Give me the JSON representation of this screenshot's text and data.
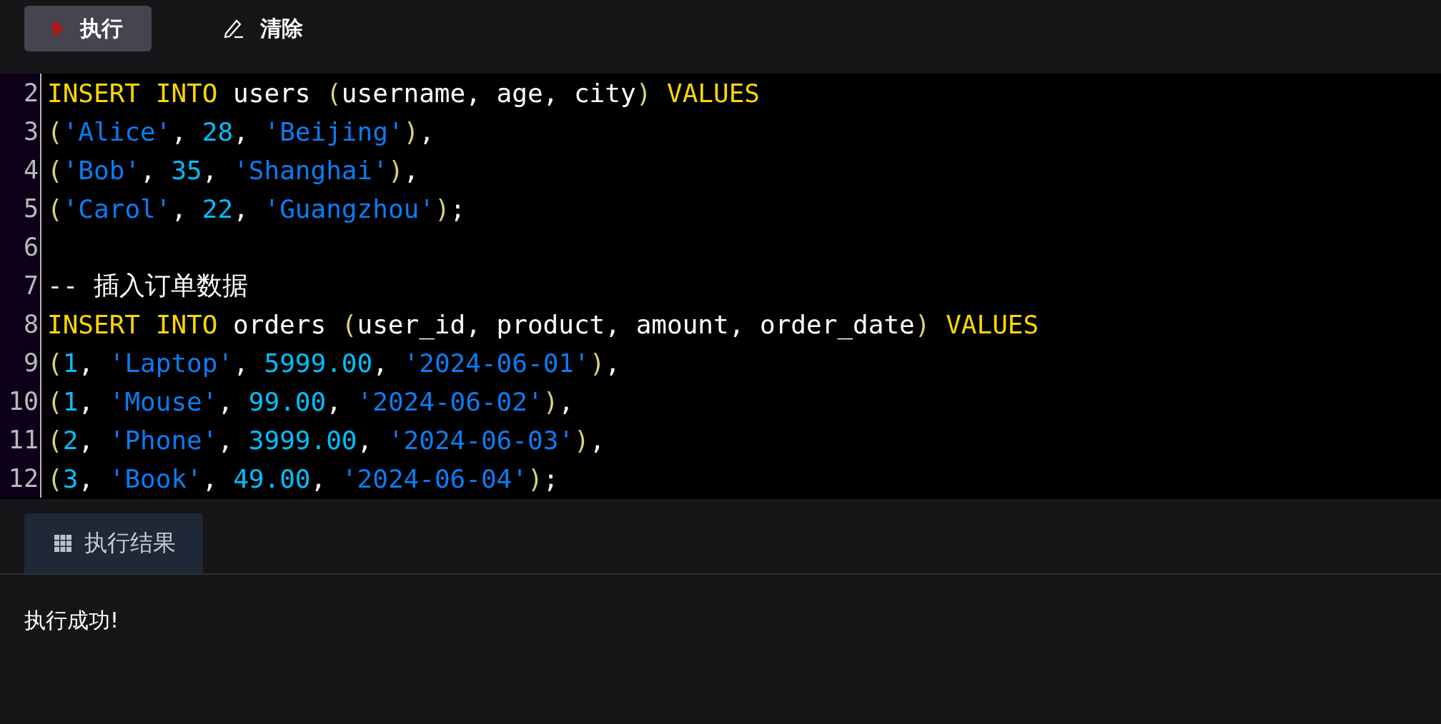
{
  "toolbar": {
    "buttons": [
      {
        "kind": "run",
        "label": "执行",
        "selected": true
      },
      {
        "kind": "clear",
        "label": "清除",
        "selected": false
      }
    ]
  },
  "editor": {
    "lines": [
      {
        "number": "2",
        "tokens": [
          {
            "kind": "keyword",
            "text": "INSERT INTO"
          },
          {
            "kind": "plain",
            "text": " users "
          },
          {
            "kind": "paren",
            "text": "("
          },
          {
            "kind": "plain",
            "text": "username, age, city"
          },
          {
            "kind": "paren",
            "text": ")"
          },
          {
            "kind": "keyword",
            "text": " VALUES"
          }
        ]
      },
      {
        "number": "3",
        "tokens": [
          {
            "kind": "paren",
            "text": "("
          },
          {
            "kind": "string",
            "text": "'Alice'"
          },
          {
            "kind": "plain",
            "text": ", "
          },
          {
            "kind": "number",
            "text": "28"
          },
          {
            "kind": "plain",
            "text": ", "
          },
          {
            "kind": "string",
            "text": "'Beijing'"
          },
          {
            "kind": "paren",
            "text": ")"
          },
          {
            "kind": "plain",
            "text": ","
          }
        ]
      },
      {
        "number": "4",
        "tokens": [
          {
            "kind": "paren",
            "text": "("
          },
          {
            "kind": "string",
            "text": "'Bob'"
          },
          {
            "kind": "plain",
            "text": ", "
          },
          {
            "kind": "number",
            "text": "35"
          },
          {
            "kind": "plain",
            "text": ", "
          },
          {
            "kind": "string",
            "text": "'Shanghai'"
          },
          {
            "kind": "paren",
            "text": ")"
          },
          {
            "kind": "plain",
            "text": ","
          }
        ]
      },
      {
        "number": "5",
        "tokens": [
          {
            "kind": "paren",
            "text": "("
          },
          {
            "kind": "string",
            "text": "'Carol'"
          },
          {
            "kind": "plain",
            "text": ", "
          },
          {
            "kind": "number",
            "text": "22"
          },
          {
            "kind": "plain",
            "text": ", "
          },
          {
            "kind": "string",
            "text": "'Guangzhou'"
          },
          {
            "kind": "paren",
            "text": ")"
          },
          {
            "kind": "plain",
            "text": ";"
          }
        ]
      },
      {
        "number": "6"
      },
      {
        "number": "7",
        "tokens": [
          {
            "kind": "plain",
            "text": "-- 插入订单数据"
          }
        ]
      },
      {
        "number": "8",
        "tokens": [
          {
            "kind": "keyword",
            "text": "INSERT INTO"
          },
          {
            "kind": "plain",
            "text": " orders "
          },
          {
            "kind": "paren",
            "text": "("
          },
          {
            "kind": "plain",
            "text": "user_id, product, amount, order_date"
          },
          {
            "kind": "paren",
            "text": ")"
          },
          {
            "kind": "keyword",
            "text": " VALUES"
          }
        ]
      },
      {
        "number": "9",
        "tokens": [
          {
            "kind": "paren",
            "text": "("
          },
          {
            "kind": "number",
            "text": "1"
          },
          {
            "kind": "plain",
            "text": ", "
          },
          {
            "kind": "string",
            "text": "'Laptop'"
          },
          {
            "kind": "plain",
            "text": ", "
          },
          {
            "kind": "number",
            "text": "5999.00"
          },
          {
            "kind": "plain",
            "text": ", "
          },
          {
            "kind": "string",
            "text": "'2024-06-01'"
          },
          {
            "kind": "paren",
            "text": ")"
          },
          {
            "kind": "plain",
            "text": ","
          }
        ]
      },
      {
        "number": "10",
        "tokens": [
          {
            "kind": "paren",
            "text": "("
          },
          {
            "kind": "number",
            "text": "1"
          },
          {
            "kind": "plain",
            "text": ", "
          },
          {
            "kind": "string",
            "text": "'Mouse'"
          },
          {
            "kind": "plain",
            "text": ", "
          },
          {
            "kind": "number",
            "text": "99.00"
          },
          {
            "kind": "plain",
            "text": ", "
          },
          {
            "kind": "string",
            "text": "'2024-06-02'"
          },
          {
            "kind": "paren",
            "text": ")"
          },
          {
            "kind": "plain",
            "text": ","
          }
        ]
      },
      {
        "number": "11",
        "tokens": [
          {
            "kind": "paren",
            "text": "("
          },
          {
            "kind": "number",
            "text": "2"
          },
          {
            "kind": "plain",
            "text": ", "
          },
          {
            "kind": "string",
            "text": "'Phone'"
          },
          {
            "kind": "plain",
            "text": ", "
          },
          {
            "kind": "number",
            "text": "3999.00"
          },
          {
            "kind": "plain",
            "text": ", "
          },
          {
            "kind": "string",
            "text": "'2024-06-03'"
          },
          {
            "kind": "paren",
            "text": ")"
          },
          {
            "kind": "plain",
            "text": ","
          }
        ]
      },
      {
        "number": "12",
        "tokens": [
          {
            "kind": "paren",
            "text": "("
          },
          {
            "kind": "number",
            "text": "3"
          },
          {
            "kind": "plain",
            "text": ", "
          },
          {
            "kind": "string",
            "text": "'Book'"
          },
          {
            "kind": "plain",
            "text": ", "
          },
          {
            "kind": "number",
            "text": "49.00"
          },
          {
            "kind": "plain",
            "text": ", "
          },
          {
            "kind": "string",
            "text": "'2024-06-04'"
          },
          {
            "kind": "paren",
            "text": ")"
          },
          {
            "kind": "plain",
            "text": ";"
          }
        ]
      }
    ]
  },
  "results": {
    "tab": {
      "label": "执行结果",
      "selected": true
    },
    "message": "执行成功!"
  }
}
